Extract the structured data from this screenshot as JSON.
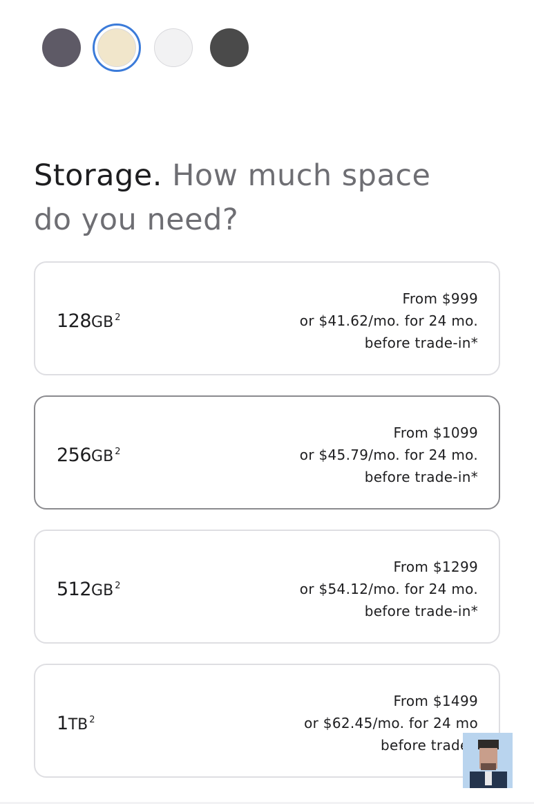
{
  "colors": {
    "swatches": [
      {
        "name": "Deep Purple",
        "hex": "#5e5a66",
        "selected": false
      },
      {
        "name": "Gold",
        "hex": "#f1e6cb",
        "selected": true
      },
      {
        "name": "Silver",
        "hex": "#f2f2f3",
        "selected": false
      },
      {
        "name": "Space Black",
        "hex": "#4a4a4a",
        "selected": false
      }
    ],
    "selection_ring": "#3b7bd9"
  },
  "storage": {
    "title": "Storage.",
    "subtitle": "How much space do you need?",
    "options": [
      {
        "capacity_number": "128",
        "capacity_unit": "GB",
        "footnote": "2",
        "price_line": "From $999",
        "monthly_line": "or $41.62/mo. for 24 mo.",
        "tradein_line": "before trade-in*"
      },
      {
        "capacity_number": "256",
        "capacity_unit": "GB",
        "footnote": "2",
        "price_line": "From $1099",
        "monthly_line": "or $45.79/mo. for 24 mo.",
        "tradein_line": "before trade-in*"
      },
      {
        "capacity_number": "512",
        "capacity_unit": "GB",
        "footnote": "2",
        "price_line": "From $1299",
        "monthly_line": "or $54.12/mo. for 24 mo.",
        "tradein_line": "before trade-in*"
      },
      {
        "capacity_number": "1",
        "capacity_unit": "TB",
        "footnote": "2",
        "price_line": "From $1499",
        "monthly_line": "or $62.45/mo. for 24 mo",
        "tradein_line": "before trade-i"
      }
    ]
  }
}
